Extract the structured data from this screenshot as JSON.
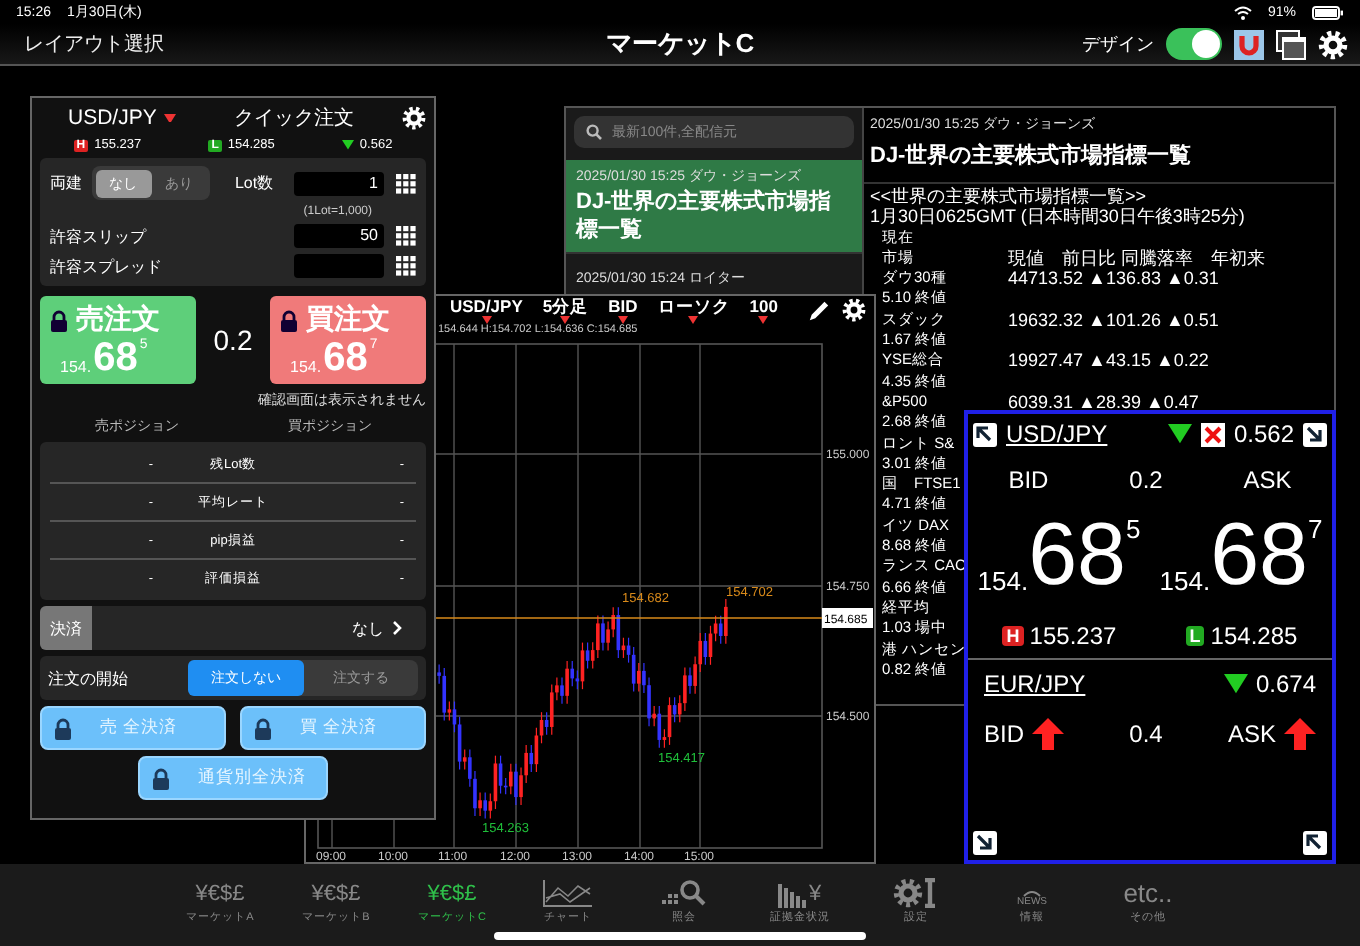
{
  "status_bar": {
    "time": "15:26",
    "date": "1月30日(木)",
    "battery": "91%"
  },
  "header": {
    "left_button": "レイアウト選択",
    "title": "マーケットC",
    "design_label": "デザイン",
    "design_on": true
  },
  "news_window": {
    "search_placeholder": "最新100件,全配信元",
    "items": [
      {
        "meta": "2025/01/30 15:25 ダウ・ジョーンズ",
        "headline": "DJ-世界の主要株式市場指標一覧",
        "selected": true
      },
      {
        "meta": "2025/01/30 15:24 ロイター",
        "selected": false
      }
    ],
    "article": {
      "meta": "2025/01/30 15:25 ダウ・ジョーンズ",
      "headline": "DJ-世界の主要株式市場指標一覧",
      "intro": [
        "<<世界の主要株式市場指標一覧>>",
        "1月30日0625GMT (日本時間30日午後3時25分)"
      ],
      "lines": [
        {
          "left": "現在"
        },
        {
          "left": "市場",
          "right": "現値　前日比 同騰落率　年初来"
        },
        {
          "left": "ダウ30種",
          "right": "44713.52 ▲136.83 ▲0.31"
        },
        {
          "left": "5.10 終値"
        },
        {
          "left": "スダック",
          "right": "19632.32 ▲101.26 ▲0.51"
        },
        {
          "left": "1.67 終値"
        },
        {
          "left": "YSE総合",
          "right": "19927.47 ▲43.15 ▲0.22"
        },
        {
          "left": "4.35 終値"
        },
        {
          "left": "&P500",
          "right": "6039.31 ▲28.39 ▲0.47"
        },
        {
          "left": "2.68 終値"
        },
        {
          "left": "ロント S&"
        },
        {
          "left": "3.01 終値"
        },
        {
          "left": "国　FTSE1"
        },
        {
          "left": "4.71 終値"
        },
        {
          "left": "イツ DAX"
        },
        {
          "left": "8.68 終値"
        },
        {
          "left": "ランス CAC"
        },
        {
          "left": "6.66 終値"
        },
        {
          "left": "経平均"
        },
        {
          "left": "1.03 場中"
        },
        {
          "left": "港 ハンセン"
        },
        {
          "left": "0.82 終値"
        }
      ]
    }
  },
  "chart_window": {
    "toolbar": [
      "USD/JPY",
      "5分足",
      "BID",
      "ローソク",
      "100"
    ],
    "ohlc": "154.644 H:154.702 L:154.636 C:154.685",
    "y_labels": [
      "155.000",
      "154.750",
      "154.500"
    ],
    "current_price": "154.685",
    "x_labels": [
      "09:00",
      "10:00",
      "11:00",
      "12:00",
      "13:00",
      "14:00",
      "15:00"
    ],
    "annotations": [
      {
        "text": "154.682",
        "kind": "high"
      },
      {
        "text": "154.702",
        "kind": "high"
      },
      {
        "text": "154.417",
        "kind": "low"
      },
      {
        "text": "154.263",
        "kind": "low"
      }
    ]
  },
  "order_window": {
    "pair": "USD/JPY",
    "title": "クイック注文",
    "high_badge": "H",
    "low_badge": "L",
    "high": "155.237",
    "low": "154.285",
    "change": "0.562",
    "hedge": {
      "label": "両建",
      "options": [
        {
          "label": "なし",
          "selected": true
        },
        {
          "label": "あり",
          "selected": false
        }
      ]
    },
    "lot": {
      "label": "Lot数",
      "value": "1",
      "note": "(1Lot=1,000)"
    },
    "slip": {
      "label": "許容スリップ",
      "value": "50"
    },
    "spread_field": {
      "label": "許容スプレッド"
    },
    "sell": {
      "label": "売注文",
      "prefix": "154.",
      "big": "68",
      "small": "5"
    },
    "spread": "0.2",
    "buy": {
      "label": "買注文",
      "prefix": "154.",
      "big": "68",
      "small": "7"
    },
    "confirm_note": "確認画面は表示されません",
    "sell_position": "売ポジション",
    "buy_position": "買ポジション",
    "position_rows": [
      {
        "sell": "-",
        "label": "残Lot数",
        "buy": "-"
      },
      {
        "sell": "-",
        "label": "平均レート",
        "buy": "-"
      },
      {
        "sell": "-",
        "label": "pip損益",
        "buy": "-"
      },
      {
        "sell": "-",
        "label": "評価損益",
        "buy": "-"
      }
    ],
    "settle": {
      "label": "決済",
      "value": "なし"
    },
    "order_start": {
      "label": "注文の開始",
      "options": [
        {
          "label": "注文しない",
          "selected": true
        },
        {
          "label": "注文する",
          "selected": false
        }
      ]
    },
    "close_buttons": [
      "売 全決済",
      "買 全決済",
      "通貨別全決済"
    ]
  },
  "rate_panel": {
    "pairs": [
      {
        "kind": "full",
        "pair": "USD/JPY",
        "change": "0.562",
        "bid_label": "BID",
        "spread": "0.2",
        "ask_label": "ASK",
        "bid": {
          "prefix": "154.",
          "big": "68",
          "small": "5"
        },
        "ask": {
          "prefix": "154.",
          "big": "68",
          "small": "7"
        },
        "high_badge": "H",
        "low_badge": "L",
        "high": "155.237",
        "low": "154.285"
      },
      {
        "kind": "compact",
        "pair": "EUR/JPY",
        "change": "0.674",
        "bid_label": "BID",
        "spread": "0.4",
        "ask_label": "ASK",
        "rising": true
      }
    ]
  },
  "tab_bar": [
    {
      "kind": "currency",
      "glyph": "¥€$£",
      "label": "マーケットA",
      "selected": false
    },
    {
      "kind": "currency",
      "glyph": "¥€$£",
      "label": "マーケットB",
      "selected": false
    },
    {
      "kind": "currency",
      "glyph": "¥€$£",
      "label": "マーケットC",
      "selected": true
    },
    {
      "kind": "chart",
      "label": "チャート",
      "selected": false
    },
    {
      "kind": "search",
      "label": "照会",
      "selected": false
    },
    {
      "kind": "margin",
      "glyph": "¥",
      "label": "証拠金状況",
      "selected": false
    },
    {
      "kind": "settings",
      "label": "設定",
      "selected": false
    },
    {
      "kind": "news",
      "glyph": "NEWS",
      "label": "情報",
      "selected": false
    },
    {
      "kind": "etc",
      "glyph": "etc..",
      "label": "その他",
      "selected": false
    }
  ]
}
